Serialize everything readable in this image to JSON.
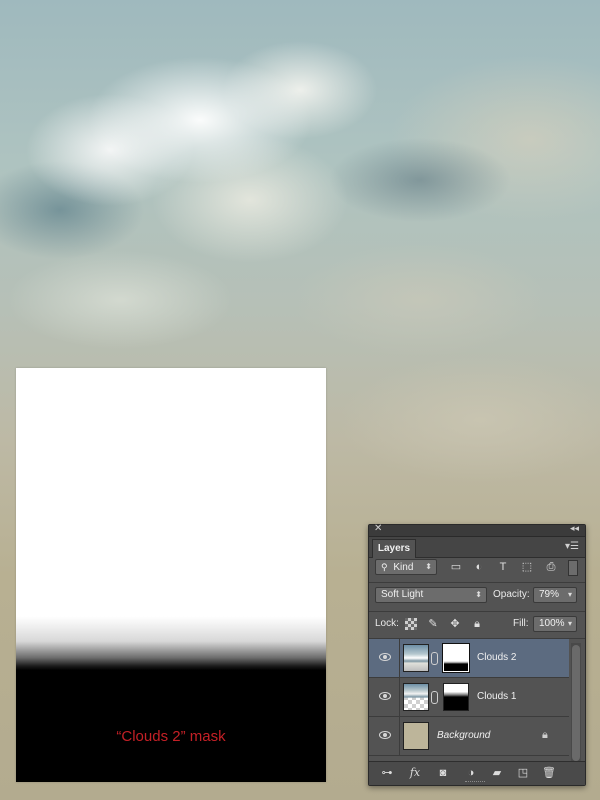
{
  "mask_preview": {
    "caption": "“Clouds 2” mask"
  },
  "layers_panel": {
    "tab_label": "Layers",
    "filter": {
      "kind_label": "Kind",
      "icons": [
        "image-filter-icon",
        "adjustment-filter-icon",
        "type-filter-icon",
        "shape-filter-icon",
        "smart-object-filter-icon",
        "filter-toggle-icon"
      ]
    },
    "blend_mode": "Soft Light",
    "opacity_label": "Opacity:",
    "opacity_value": "79%",
    "lock_label": "Lock:",
    "fill_label": "Fill:",
    "fill_value": "100%",
    "layers": [
      {
        "name": "Clouds 2",
        "selected": true,
        "visible": true
      },
      {
        "name": "Clouds 1",
        "selected": false,
        "visible": true
      },
      {
        "name": "Background",
        "selected": false,
        "visible": true,
        "locked": true
      }
    ],
    "bottom_icons": [
      "link-layers-icon",
      "fx-icon",
      "add-mask-icon",
      "adjustment-layer-icon",
      "group-folder-icon",
      "new-layer-icon",
      "trash-icon"
    ],
    "fx_label": "fx"
  }
}
